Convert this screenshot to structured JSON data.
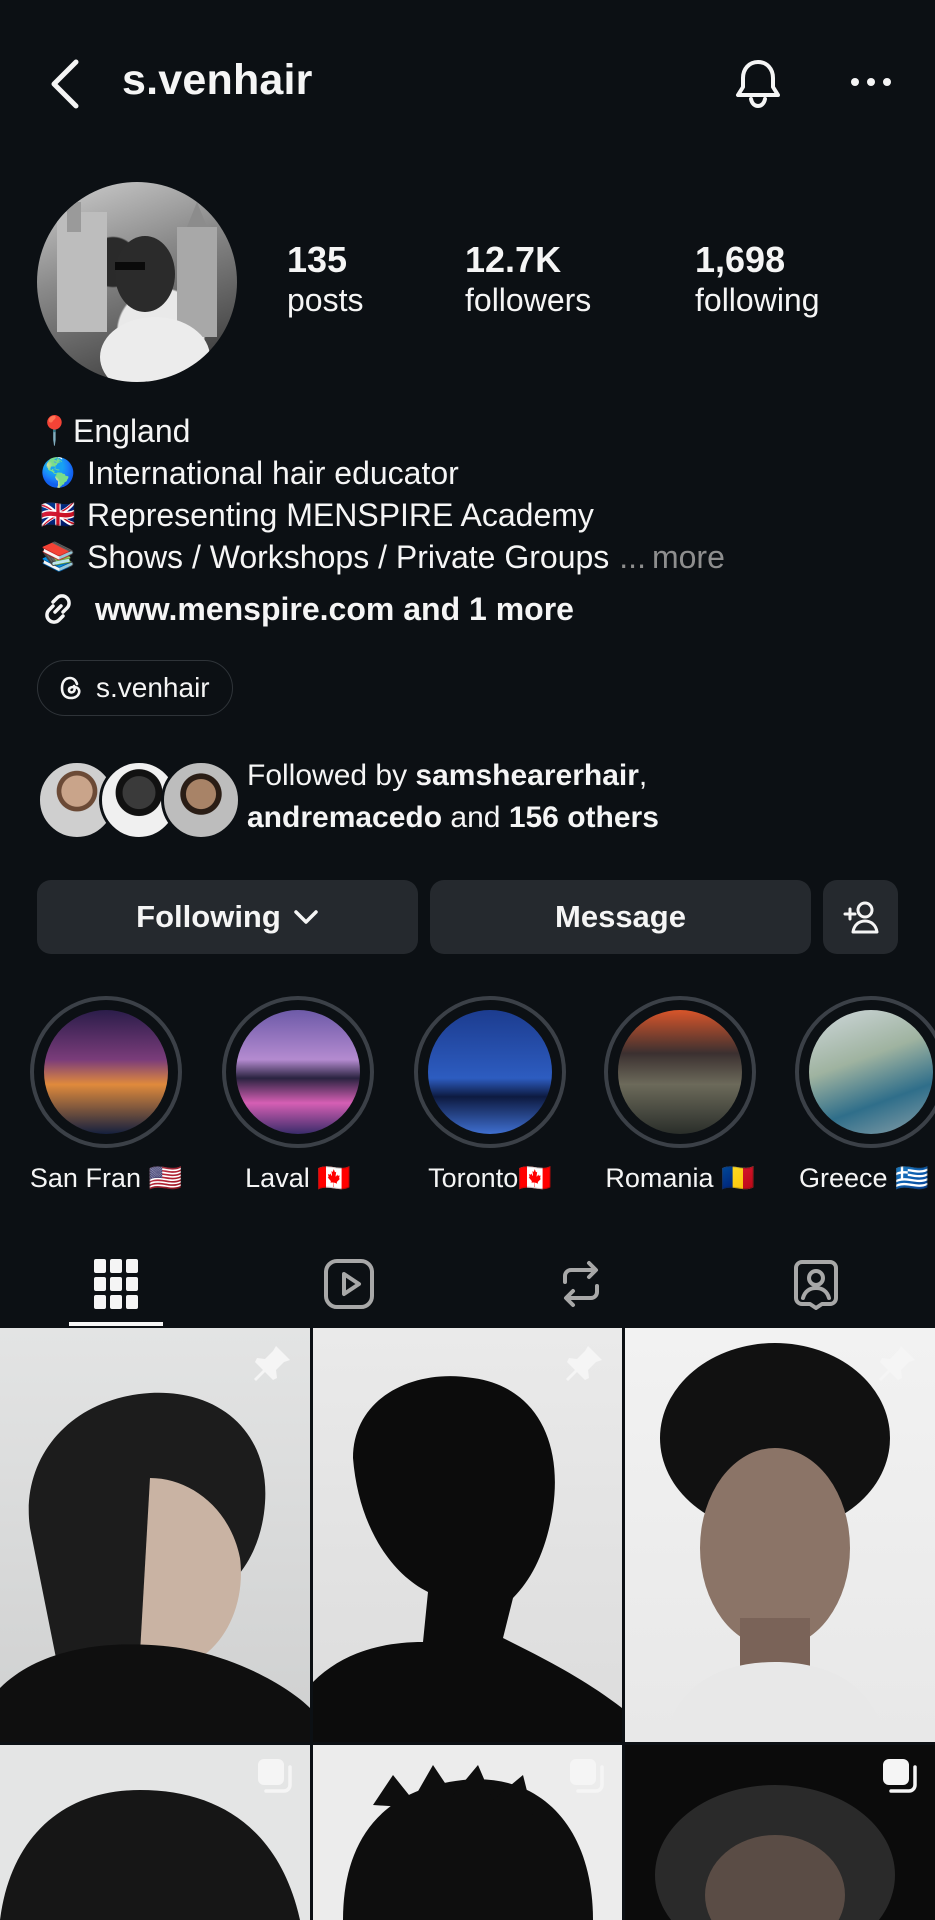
{
  "header": {
    "username": "s.venhair"
  },
  "profile": {
    "stats": [
      {
        "value": "135",
        "label": "posts"
      },
      {
        "value": "12.7K",
        "label": "followers"
      },
      {
        "value": "1,698",
        "label": "following"
      }
    ],
    "bio": [
      {
        "emoji": "📍",
        "text": "England"
      },
      {
        "emoji": "🌎",
        "text": "International hair educator"
      },
      {
        "emoji": "🇬🇧",
        "text": "Representing MENSPIRE Academy"
      },
      {
        "emoji": "📚",
        "text": "Shows / Workshops / Private Groups"
      }
    ],
    "bio_more_ellipsis": "...",
    "bio_more": "more",
    "link_text": "www.menspire.com and 1 more",
    "threads_handle": "s.venhair",
    "followed_by": {
      "prefix": "Followed by ",
      "user1": "samshearerhair",
      "comma": ",",
      "user2": "andremacedo",
      "and": " and ",
      "others": "156 others"
    }
  },
  "actions": {
    "following_label": "Following",
    "message_label": "Message"
  },
  "highlights": [
    {
      "label": "San Fran 🇺🇸"
    },
    {
      "label": "Laval 🇨🇦"
    },
    {
      "label": "Toronto🇨🇦"
    },
    {
      "label": "Romania 🇷🇴"
    },
    {
      "label": "Greece 🇬🇷"
    }
  ],
  "tabs": [
    "grid-icon",
    "reels-icon",
    "reposts-icon",
    "tagged-icon"
  ],
  "grid_posts": [
    {
      "badge": "pin-icon"
    },
    {
      "badge": "pin-icon"
    },
    {
      "badge": "pin-icon"
    },
    {
      "badge": "carousel-icon"
    },
    {
      "badge": "carousel-icon"
    },
    {
      "badge": "carousel-icon"
    }
  ],
  "colors": {
    "background": "#0c1014",
    "button": "#25292e",
    "text": "#f5f5f5",
    "muted": "#8e8e8e"
  }
}
